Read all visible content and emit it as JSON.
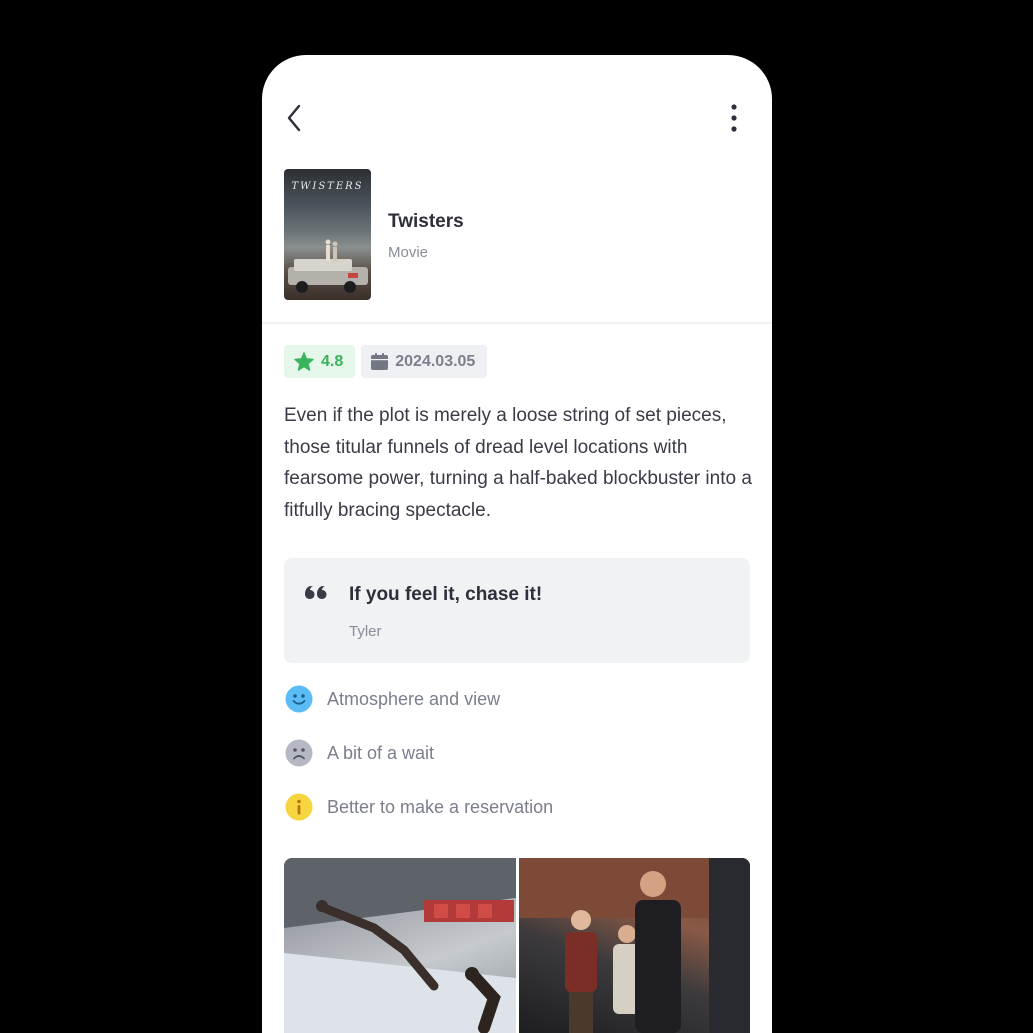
{
  "toolbar": {
    "back_icon": "chevron-left-icon",
    "more_icon": "more-vertical-icon"
  },
  "media": {
    "title": "Twisters",
    "type": "Movie",
    "poster_text": "TWISTERS"
  },
  "meta": {
    "rating": "4.8",
    "rating_icon": "star-icon",
    "rating_color": "#3bb35c",
    "date": "2024.03.05",
    "date_icon": "calendar-icon"
  },
  "review": {
    "text": "Even if the plot is merely a loose string of set pieces, those titular funnels of dread level locations with fearsome power, turning a half-baked blockbuster into a fitfully bracing spectacle."
  },
  "quote": {
    "icon": "quote-icon",
    "text": "If you feel it, chase it!",
    "author": "Tyler"
  },
  "notes": [
    {
      "icon": "smile-face-icon",
      "color": "#5bbcf5",
      "label": "Atmosphere and view"
    },
    {
      "icon": "sad-face-icon",
      "color": "#b6b8c3",
      "label": "A bit of a wait"
    },
    {
      "icon": "info-icon",
      "color": "#f7d540",
      "label": "Better to make a reservation"
    }
  ]
}
